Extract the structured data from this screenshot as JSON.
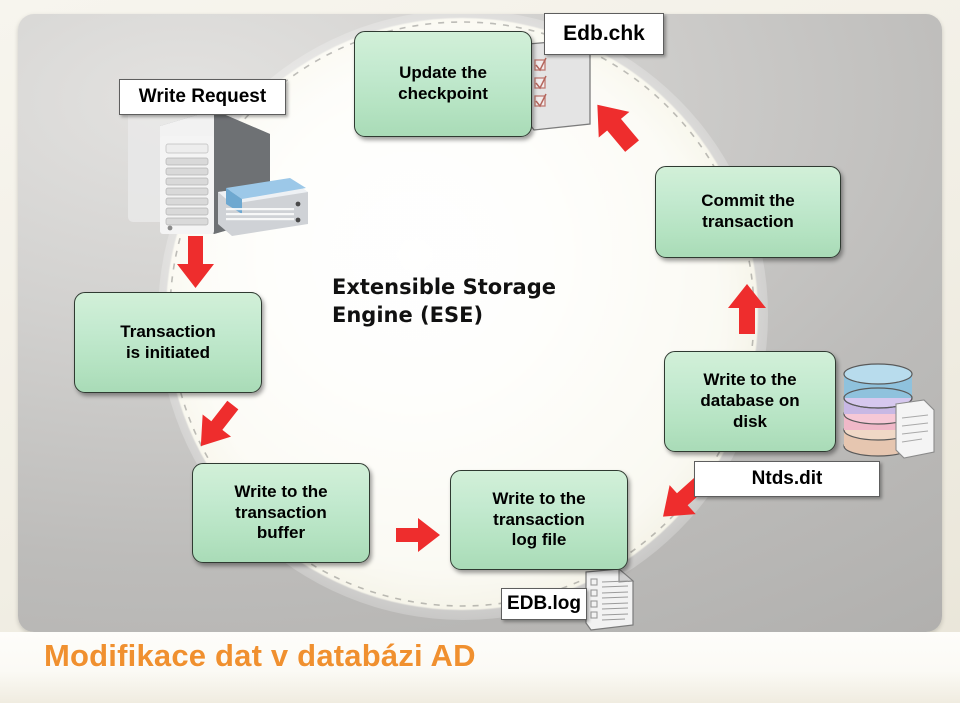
{
  "slide": {
    "title": "Modifikace dat v databázi AD",
    "center_label": "Extensible Storage\nEngine (ESE)",
    "center_label_line1": "Extensible Storage",
    "center_label_line2": "Engine (ESE)",
    "accent_color": "#f0902f",
    "process_box_color": "#c4ead0",
    "arrow_color": "#ee2d2d"
  },
  "process_steps": [
    {
      "id": "transaction-initiated",
      "line1": "Transaction",
      "line2": "is initiated",
      "line3": ""
    },
    {
      "id": "write-transaction-buffer",
      "line1": "Write to the",
      "line2": "transaction",
      "line3": "buffer"
    },
    {
      "id": "write-transaction-log-file",
      "line1": "Write to the",
      "line2": "transaction",
      "line3": "log file"
    },
    {
      "id": "write-database-on-disk",
      "line1": "Write to the",
      "line2": "database on",
      "line3": "disk"
    },
    {
      "id": "commit-transaction",
      "line1": "Commit the",
      "line2": "transaction",
      "line3": ""
    },
    {
      "id": "update-checkpoint",
      "line1": "Update the",
      "line2": "checkpoint",
      "line3": ""
    }
  ],
  "callouts": [
    {
      "id": "write-request",
      "label": "Write Request"
    },
    {
      "id": "edb-chk",
      "label": "Edb.chk"
    },
    {
      "id": "ntds-dit",
      "label": "Ntds.dit"
    },
    {
      "id": "edb-log",
      "label": "EDB.log"
    }
  ],
  "icons": [
    {
      "id": "server-icon",
      "name": "server-tower-with-binder"
    },
    {
      "id": "checkpoint-file-icon",
      "name": "checklist-document"
    },
    {
      "id": "database-stack-icon",
      "name": "database-cylinders"
    },
    {
      "id": "log-file-icon",
      "name": "log-document"
    }
  ],
  "arrows": [
    {
      "id": "arrow-server-to-transaction",
      "direction": "down"
    },
    {
      "id": "arrow-transaction-to-buffer",
      "direction": "down-right"
    },
    {
      "id": "arrow-buffer-to-log",
      "direction": "right"
    },
    {
      "id": "arrow-log-to-ntds",
      "direction": "up-right"
    },
    {
      "id": "arrow-disk-to-commit",
      "direction": "up"
    },
    {
      "id": "arrow-commit-to-checkpoint",
      "direction": "up-left"
    }
  ]
}
